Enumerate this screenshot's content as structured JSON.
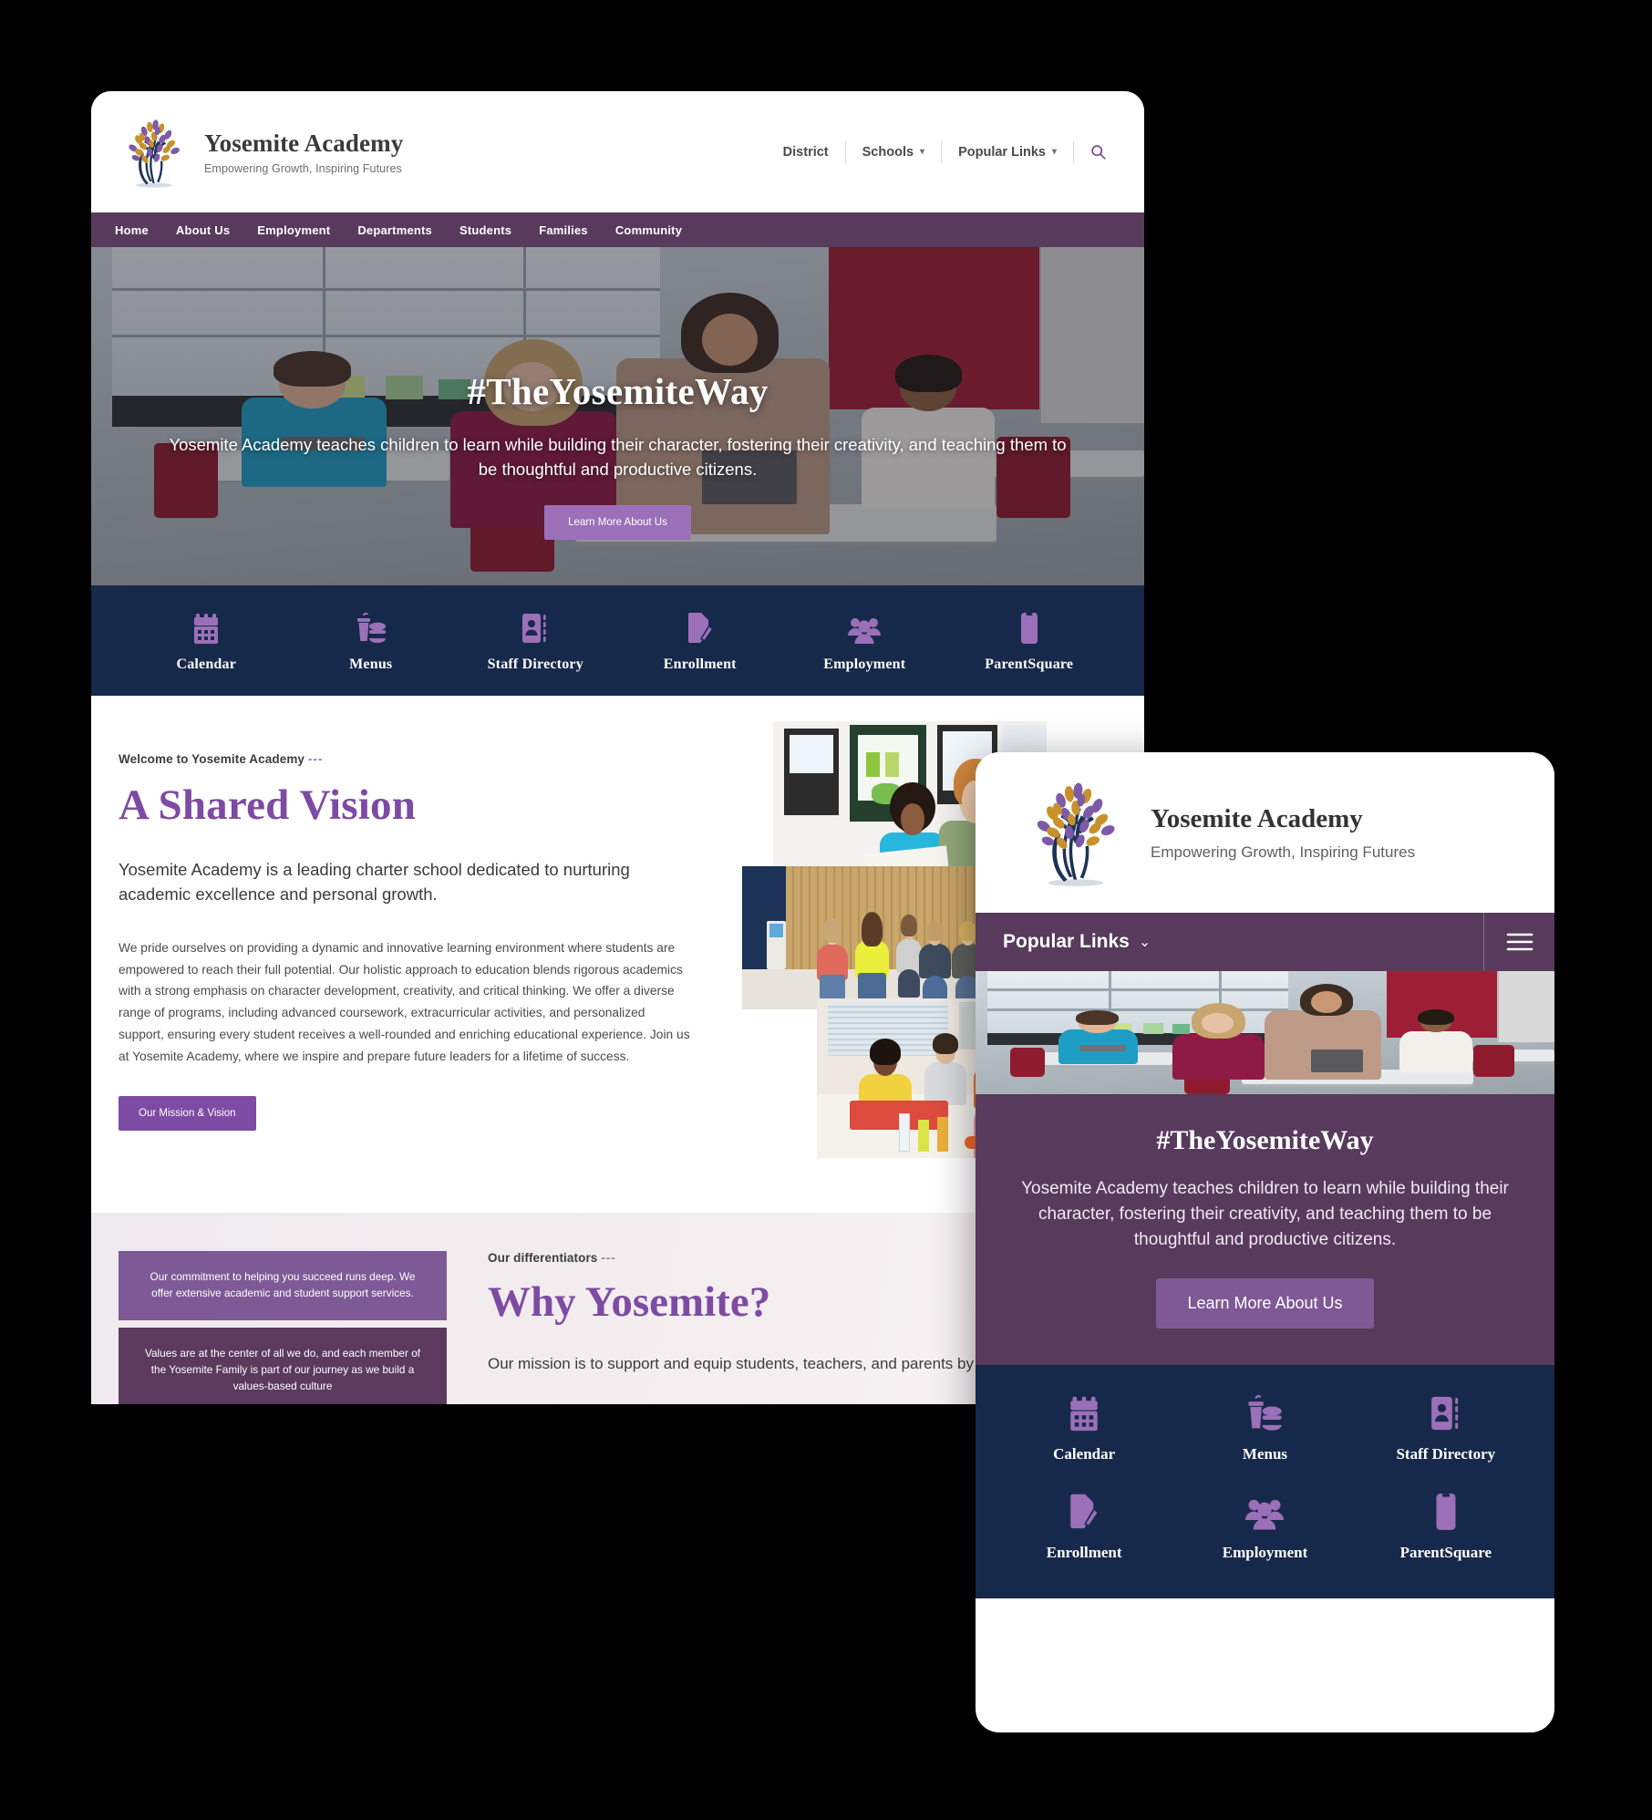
{
  "brand": {
    "name": "Yosemite Academy",
    "tagline": "Empowering Growth, Inspiring Futures",
    "logo_icon": "tree-logo"
  },
  "colors": {
    "nav_purple": "#573a5c",
    "accent_purple": "#7d4ba3",
    "light_purple": "#9b70b8",
    "dark_navy": "#17294a",
    "card_purple_light": "#7d5a96",
    "card_purple_dark": "#5b3a5e"
  },
  "desktop": {
    "utility_nav": [
      {
        "label": "District",
        "caret": false
      },
      {
        "label": "Schools",
        "caret": true
      },
      {
        "label": "Popular Links",
        "caret": true
      }
    ],
    "search_icon": "search-icon",
    "main_nav": [
      "Home",
      "About Us",
      "Employment",
      "Departments",
      "Students",
      "Families",
      "Community"
    ],
    "hero": {
      "title": "#TheYosemiteWay",
      "subtitle": "Yosemite Academy teaches children to learn while building their character, fostering their creativity, and teaching them to be thoughtful and productive citizens.",
      "button": "Learn More About Us"
    },
    "quick_links": [
      {
        "label": "Calendar",
        "icon": "calendar-icon"
      },
      {
        "label": "Menus",
        "icon": "meal-icon"
      },
      {
        "label": "Staff Directory",
        "icon": "contact-card-icon"
      },
      {
        "label": "Enrollment",
        "icon": "document-pencil-icon"
      },
      {
        "label": "Employment",
        "icon": "people-icon"
      },
      {
        "label": "ParentSquare",
        "icon": "mobile-phone-icon"
      }
    ],
    "vision": {
      "eyebrow": "Welcome to Yosemite Academy",
      "eyebrow_dash": "---",
      "heading": "A Shared Vision",
      "lead": "Yosemite Academy is a leading charter school dedicated to nurturing academic excellence and personal growth.",
      "body": "We pride ourselves on providing a dynamic and innovative learning environment where students are empowered to reach their full potential. Our holistic approach to education blends rigorous academics with a strong emphasis on character development, creativity, and critical thinking. We offer a diverse range of programs, including advanced coursework, extracurricular activities, and personalized support, ensuring every student receives a well-rounded and enriching educational experience. Join us at Yosemite Academy, where we inspire and prepare future leaders for a lifetime of success.",
      "button": "Our Mission & Vision"
    },
    "why": {
      "eyebrow": "Our differentiators",
      "eyebrow_dash": "---",
      "heading": "Why Yosemite?",
      "body": "Our mission is to support and equip students, teachers, and parents by p",
      "cards": [
        "Our commitment to helping you succeed runs deep. We offer extensive academic and student support services.",
        "Values are at the center of all we do, and each member of the Yosemite Family is part of our journey as we build a values-based culture"
      ]
    }
  },
  "mobile": {
    "nav_label": "Popular Links",
    "nav_caret": "⌄",
    "menu_icon": "hamburger-menu-icon",
    "hero": {
      "title": "#TheYosemiteWay",
      "subtitle": "Yosemite Academy teaches children to learn while building their character, fostering their creativity, and teaching them to be thoughtful and productive citizens.",
      "button": "Learn More About Us"
    },
    "quick_links": [
      {
        "label": "Calendar",
        "icon": "calendar-icon"
      },
      {
        "label": "Menus",
        "icon": "meal-icon"
      },
      {
        "label": "Staff Directory",
        "icon": "contact-card-icon"
      },
      {
        "label": "Enrollment",
        "icon": "document-pencil-icon"
      },
      {
        "label": "Employment",
        "icon": "people-icon"
      },
      {
        "label": "ParentSquare",
        "icon": "mobile-phone-icon"
      }
    ]
  }
}
